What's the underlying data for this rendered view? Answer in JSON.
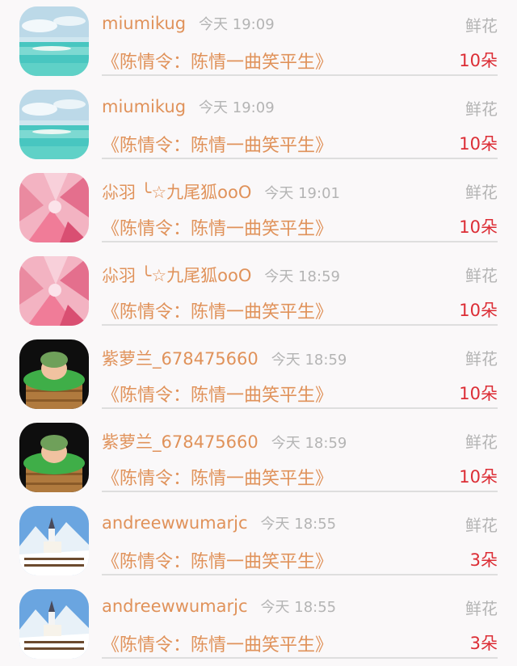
{
  "gifts": [
    {
      "user": "miumikug",
      "time": "今天 19:09",
      "gift_type": "鲜花",
      "title": "《陈情令：陈情一曲笑平生》",
      "count": "10朵",
      "avatar_icon": "beach-avatar-icon"
    },
    {
      "user": "miumikug",
      "time": "今天 19:09",
      "gift_type": "鲜花",
      "title": "《陈情令：陈情一曲笑平生》",
      "count": "10朵",
      "avatar_icon": "beach-avatar-icon"
    },
    {
      "user": "尛羽 ╰☆九尾狐ooO",
      "time": "今天 19:01",
      "gift_type": "鲜花",
      "title": "《陈情令：陈情一曲笑平生》",
      "count": "10朵",
      "avatar_icon": "pink-feather-avatar-icon"
    },
    {
      "user": "尛羽 ╰☆九尾狐ooO",
      "time": "今天 18:59",
      "gift_type": "鲜花",
      "title": "《陈情令：陈情一曲笑平生》",
      "count": "10朵",
      "avatar_icon": "pink-feather-avatar-icon"
    },
    {
      "user": "紫萝兰_678475660",
      "time": "今天 18:59",
      "gift_type": "鲜花",
      "title": "《陈情令：陈情一曲笑平生》",
      "count": "10朵",
      "avatar_icon": "baby-basket-avatar-icon"
    },
    {
      "user": "紫萝兰_678475660",
      "time": "今天 18:59",
      "gift_type": "鲜花",
      "title": "《陈情令：陈情一曲笑平生》",
      "count": "10朵",
      "avatar_icon": "baby-basket-avatar-icon"
    },
    {
      "user": "andreewwumarjc",
      "time": "今天 18:55",
      "gift_type": "鲜花",
      "title": "《陈情令：陈情一曲笑平生》",
      "count": "3朵",
      "avatar_icon": "snow-church-avatar-icon"
    },
    {
      "user": "andreewwumarjc",
      "time": "今天 18:55",
      "gift_type": "鲜花",
      "title": "《陈情令：陈情一曲笑平生》",
      "count": "3朵",
      "avatar_icon": "snow-church-avatar-icon"
    }
  ]
}
